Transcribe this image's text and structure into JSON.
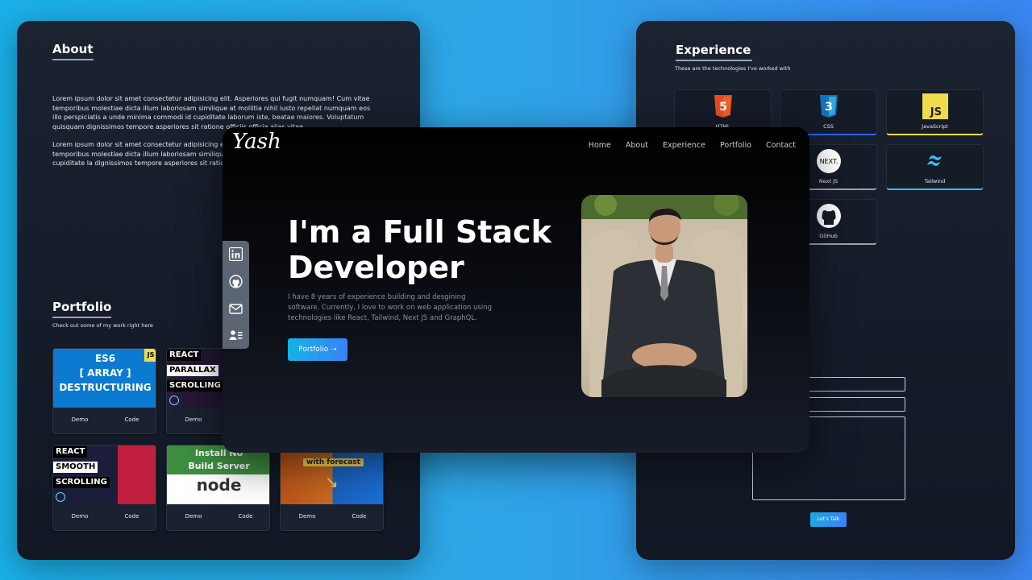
{
  "about": {
    "title": "About",
    "paragraph_1": "Lorem ipsum dolor sit amet consectetur adipisicing elit. Asperiores qui fugit numquam! Cum vitae temporibus molestiae dicta illum laboriosam similique at mollitia nihil iusto repellat numquam eos illo perspiciatis a unde minima commodi id cupiditate laborum iste, beatae maiores. Voluptatum quisquam dignissimos tempore asperiores sit ratione officiis officia alias vitae.",
    "paragraph_2": "Lorem ipsum dolor sit amet consectetur adipisicing elit. Asperiores qui fugit numquam! Cum vitae temporibus molestiae dicta illum laboriosam similique a perspiciatis a unde minima commodi id cupiditate la dignissimos tempore asperiores sit ratione officiis"
  },
  "portfolio": {
    "title": "Portfolio",
    "subtitle": "Check out some of my work right here",
    "demo_label": "Demo",
    "code_label": "Code",
    "thumbs": {
      "es6": {
        "badge": "JS",
        "line1": "ES6",
        "line2": "[ ARRAY ]",
        "line3": "DESTRUCTURING"
      },
      "parallax": {
        "line1": "REACT",
        "line2": "PARALLAX",
        "line3": "SCROLLING"
      },
      "smooth": {
        "line1": "REACT",
        "line2": "SMOOTH",
        "line3": "SCROLLING"
      },
      "node": {
        "line1": "Install No",
        "line2": "Build Server",
        "logo": "node"
      },
      "weather": {
        "line1": "with forecast"
      }
    }
  },
  "experience": {
    "title": "Experience",
    "subtitle": "These are the technologies I've worked with",
    "items": [
      {
        "name": "HTML",
        "icon": "html5-icon",
        "accent": "#e44d26"
      },
      {
        "name": "CSS",
        "icon": "css3-icon",
        "accent": "#2965f1"
      },
      {
        "name": "JavaScript",
        "icon": "javascript-icon",
        "accent": "#f0db4f"
      },
      {
        "name": "Next JS",
        "icon": "nextjs-icon",
        "accent": "#9ba3ad"
      },
      {
        "name": "Tailwind",
        "icon": "tailwind-icon",
        "accent": "#38bdf8"
      },
      {
        "name": "GitHub",
        "icon": "github-icon",
        "accent": "#9ba3ad"
      }
    ]
  },
  "contact": {
    "button_label": "Let's Talk"
  },
  "hero": {
    "logo": "Yash",
    "nav": [
      "Home",
      "About",
      "Experience",
      "Portfolio",
      "Contact"
    ],
    "title_line1": "I'm a Full Stack",
    "title_line2": "Developer",
    "description": "I have 8 years of experience building and desgining software. Currently, I love to work on web application using technologies like React, Tailwind, Next JS and GraphQL.",
    "cta_label": "Portfolio ➝"
  },
  "social": [
    "linkedin-icon",
    "github-icon",
    "mail-icon",
    "resume-icon"
  ],
  "colors": {
    "accent_start": "#12b3e4",
    "accent_end": "#3a82f5",
    "panel_bg": "#1b2230"
  }
}
